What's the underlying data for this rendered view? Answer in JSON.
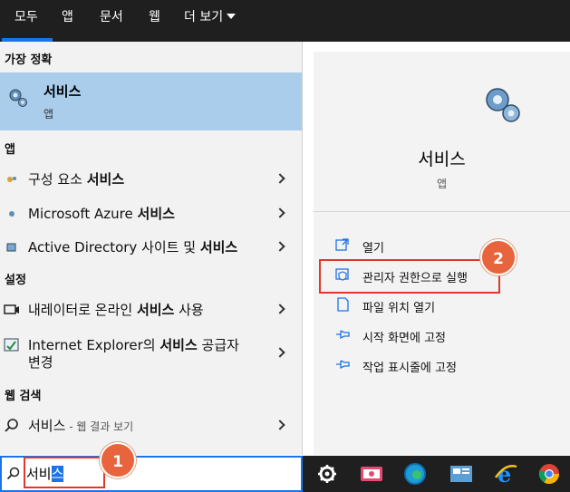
{
  "tabs": [
    "모두",
    "앱",
    "문서",
    "웹",
    "더 보기"
  ],
  "left": {
    "best_match_header": "가장 정확",
    "best_match": {
      "title": "서비스",
      "subtitle": "앱"
    },
    "apps_header": "앱",
    "apps": [
      {
        "plain": "구성 요소 ",
        "bold": "서비스"
      },
      {
        "plain": "Microsoft Azure ",
        "bold": "서비스"
      },
      {
        "plain": "Active Directory 사이트 및 ",
        "bold": "서비스"
      }
    ],
    "settings_header": "설정",
    "settings": [
      {
        "plain": "내레이터로 온라인 ",
        "bold": "서비스",
        "plain2": " 사용"
      },
      {
        "plain": "Internet Explorer의 ",
        "bold": "서비스",
        "plain2": " 공급자",
        "line2": "변경"
      }
    ],
    "web_header": "웹 검색",
    "web": {
      "query": "서비스",
      "suffix": " - 웹 결과 보기"
    }
  },
  "right": {
    "title": "서비스",
    "subtitle": "앱",
    "actions": [
      "열기",
      "관리자 권한으로 실행",
      "파일 위치 열기",
      "시작 화면에 고정",
      "작업 표시줄에 고정"
    ]
  },
  "search": {
    "typed": "서비",
    "selected": "스"
  },
  "annotations": {
    "badge1": "1",
    "badge2": "2"
  },
  "colors": {
    "accent": "#1a73e8",
    "highlight": "#a9cdeb",
    "badge": "#e8643c",
    "redbox": "#e0382a"
  }
}
